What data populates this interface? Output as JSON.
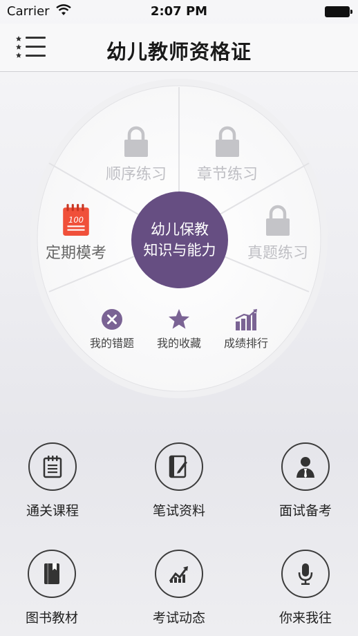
{
  "status_bar": {
    "carrier": "Carrier",
    "time": "2:07 PM"
  },
  "nav": {
    "title": "幼儿教师资格证",
    "menu_icon": "star-list-icon"
  },
  "wheel": {
    "center": {
      "line1": "幼儿保教",
      "line2": "知识与能力"
    },
    "segments": [
      {
        "label": "顺序练习",
        "locked": true
      },
      {
        "label": "章节练习",
        "locked": true
      },
      {
        "label": "真题练习",
        "locked": true
      },
      {
        "label": "定期模考",
        "locked": false,
        "icon": "exam-notepad-icon"
      }
    ],
    "shortcuts": [
      {
        "label": "我的错题",
        "icon": "wrong-x-icon"
      },
      {
        "label": "我的收藏",
        "icon": "star-icon"
      },
      {
        "label": "成绩排行",
        "icon": "ranking-bars-icon"
      }
    ],
    "accent_color": "#664e82",
    "notepad_color": "#f0503a"
  },
  "grid": [
    {
      "label": "通关课程",
      "icon": "notepad-icon"
    },
    {
      "label": "笔试资料",
      "icon": "notebook-pen-icon"
    },
    {
      "label": "面试备考",
      "icon": "person-suit-icon"
    },
    {
      "label": "图书教材",
      "icon": "book-icon"
    },
    {
      "label": "考试动态",
      "icon": "trend-chart-icon"
    },
    {
      "label": "你来我往",
      "icon": "microphone-icon"
    }
  ]
}
